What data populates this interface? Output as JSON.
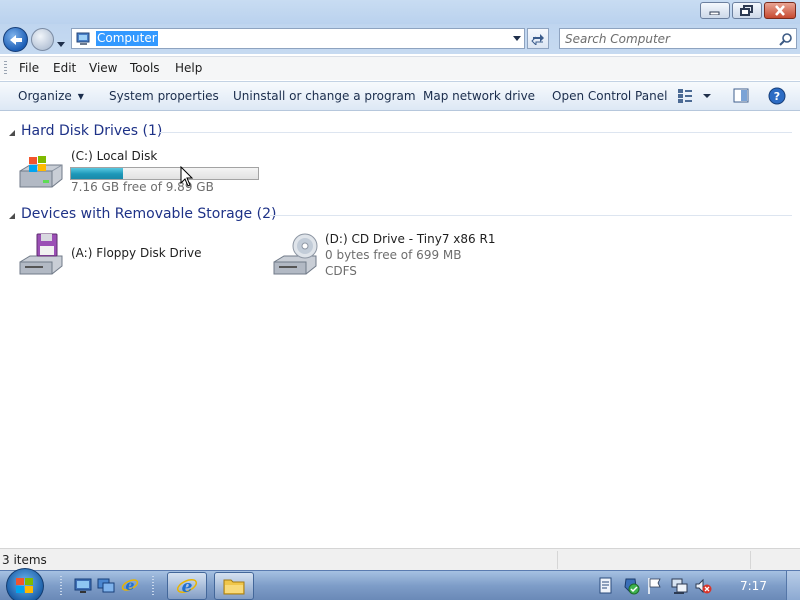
{
  "window": {
    "minimize_icon": "minimize-icon",
    "maximize_icon": "restore-icon",
    "close_icon": "close-icon"
  },
  "address": {
    "value": "Computer",
    "icon": "computer-icon"
  },
  "search": {
    "placeholder": "Search Computer",
    "icon": "magnifier-icon"
  },
  "menu": {
    "file": "File",
    "edit": "Edit",
    "view": "View",
    "tools": "Tools",
    "help": "Help"
  },
  "commands": {
    "organize": "Organize",
    "system_properties": "System properties",
    "uninstall": "Uninstall or change a program",
    "map_drive": "Map network drive",
    "control_panel": "Open Control Panel"
  },
  "groups": {
    "hard_disk": {
      "title": "Hard Disk Drives (1)",
      "drives": [
        {
          "name": "(C:) Local Disk",
          "free": "7.16 GB free of 9.89 GB",
          "used_fraction": 0.276,
          "icon": "windows-hard-disk-icon"
        }
      ]
    },
    "removable": {
      "title": "Devices with Removable Storage (2)",
      "drives": [
        {
          "name": "(A:) Floppy Disk Drive",
          "icon": "floppy-drive-icon"
        },
        {
          "name": "(D:) CD Drive - Tiny7 x86 R1",
          "free": "0 bytes free of 699 MB",
          "fs": "CDFS",
          "icon": "cd-drive-icon"
        }
      ]
    }
  },
  "status": {
    "items": "3 items"
  },
  "taskbar": {
    "clock": "7:17",
    "accent": "#7e9dc8"
  },
  "colors": {
    "group_title": "#1e3287",
    "usage_fill": "#1d97b8",
    "selection": "#3399ff"
  }
}
